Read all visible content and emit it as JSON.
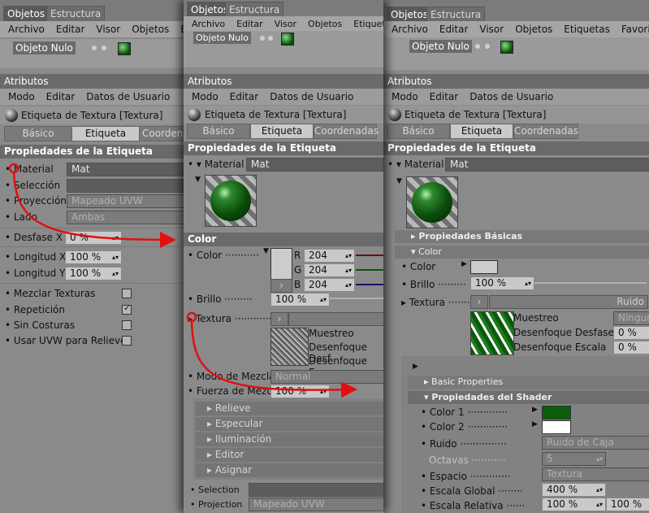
{
  "common": {
    "tab_objects": "Objetos",
    "tab_structure": "Estructura",
    "menu_file": "Archivo",
    "menu_edit": "Editar",
    "menu_view": "Visor",
    "menu_objects": "Objetos",
    "menu_tags": "Etiquetas",
    "menu_favorites": "Favoritos",
    "object_name": "Objeto Nulo",
    "attributes": "Atributos",
    "sub_mode": "Modo",
    "sub_edit": "Editar",
    "sub_userdata": "Datos de Usuario",
    "tag_title": "Etiqueta de Textura [Textura]",
    "seg_basic": "Básico",
    "seg_tag": "Etiqueta",
    "seg_coords": "Coordenadas",
    "seg_coords_cut": "Coordena",
    "tag_props": "Propiedades de la Etiqueta",
    "material_label": "Material",
    "material_value": "Mat"
  },
  "panel1": {
    "menu_edit_cut": "E",
    "selection_label": "Selección",
    "projection_label": "Proyección",
    "projection_value": "Mapeado UVW",
    "side_label": "Lado",
    "side_value": "Ambas",
    "offset_x_label": "Desfase X",
    "offset_x_value": "0 %",
    "length_x_label": "Longitud X",
    "length_x_value": "100 %",
    "length_y_label": "Longitud Y",
    "length_y_value": "100 %",
    "mix_label": "Mezclar Texturas",
    "repeat_label": "Repetición",
    "seamless_label": "Sin Costuras",
    "uvw_label": "Usar UVW para Relieve"
  },
  "panel2": {
    "color_section": "Color",
    "color_label": "Color",
    "r_label": "R",
    "r_value": "204",
    "g_label": "G",
    "g_value": "204",
    "b_label": "B",
    "b_value": "204",
    "brightness_label": "Brillo",
    "brightness_value": "100 %",
    "texture_label": "Textura",
    "texture_button_cut": "R",
    "sampling": "Muestreo",
    "blur_offset": "Desenfoque Desf",
    "blur_scale": "Desenfoque Esca",
    "blend_mode_label": "Modo de Mezcla",
    "blend_mode_value": "Normal",
    "blend_strength_label": "Fuerza de Mezcla",
    "blend_strength_value": "100 %",
    "channels": [
      "Relieve",
      "Especular",
      "Iluminación",
      "Editor",
      "Asignar"
    ],
    "selection_label": "Selection",
    "projection_label": "Projection",
    "projection_value": "Mapeado UVW"
  },
  "panel3": {
    "basic_props": "Propiedades Básicas",
    "color_section": "Color",
    "color_label": "Color",
    "brightness_label": "Brillo",
    "brightness_value": "100 %",
    "texture_label": "Textura",
    "texture_button": "Ruido",
    "sampling": "Muestreo",
    "sampling_value": "Ningun",
    "blur_offset": "Desenfoque Desfase",
    "blur_offset_value": "0 %",
    "blur_scale": "Desenfoque Escala",
    "blur_scale_value": "0 %",
    "basic_properties": "Basic Properties",
    "shader_props": "Propiedades del Shader",
    "color1_label": "Color 1",
    "color2_label": "Color 2",
    "noise_label": "Ruido",
    "noise_value": "Ruido de Caja",
    "octaves_label": "Octavas",
    "octaves_value": "5",
    "space_label": "Espacio",
    "space_value": "Textura",
    "global_scale_label": "Escala Global",
    "global_scale_value": "400 %",
    "relative_scale_label": "Escala Relativa",
    "relative_scale_value_1": "100 %",
    "relative_scale_value_2": "100 %"
  },
  "colors": {
    "arrow_red": "#e01010",
    "color1_green": "#0b5e0b",
    "color2_white": "#ffffff",
    "swatch_grey": "#cccccc"
  }
}
